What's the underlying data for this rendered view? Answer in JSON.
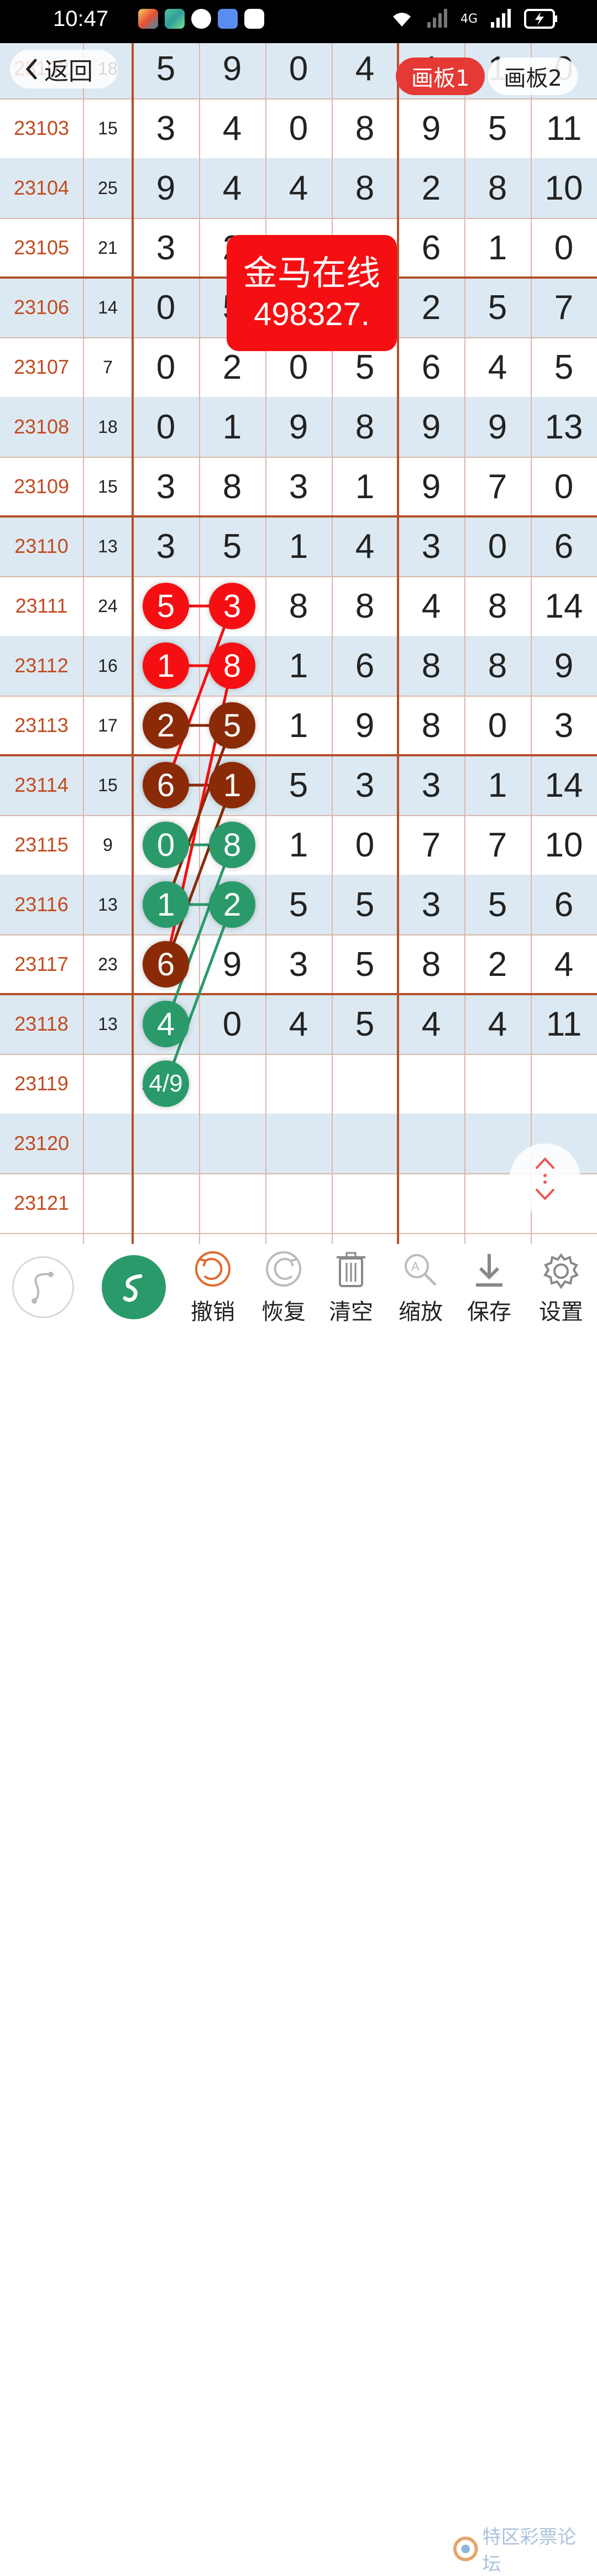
{
  "status_bar": {
    "time": "10:47",
    "network": "4G"
  },
  "nav": {
    "back_label": "返回"
  },
  "tabs": [
    {
      "label": "画板1",
      "active": true
    },
    {
      "label": "画板2",
      "active": false
    }
  ],
  "stamp": {
    "line1": "金马在线",
    "line2": "498327."
  },
  "rows": [
    {
      "id": "23102",
      "sum": "18",
      "nums": [
        "5",
        "9",
        "0",
        "4",
        "1",
        "1",
        "0"
      ]
    },
    {
      "id": "23103",
      "sum": "15",
      "nums": [
        "3",
        "4",
        "0",
        "8",
        "9",
        "5",
        "11"
      ]
    },
    {
      "id": "23104",
      "sum": "25",
      "nums": [
        "9",
        "4",
        "4",
        "8",
        "2",
        "8",
        "10"
      ]
    },
    {
      "id": "23105",
      "sum": "21",
      "nums": [
        "3",
        "2",
        "",
        "",
        "6",
        "1",
        "0"
      ]
    },
    {
      "id": "23106",
      "sum": "14",
      "nums": [
        "0",
        "5",
        "",
        "",
        "2",
        "5",
        "7"
      ]
    },
    {
      "id": "23107",
      "sum": "7",
      "nums": [
        "0",
        "2",
        "0",
        "5",
        "6",
        "4",
        "5"
      ]
    },
    {
      "id": "23108",
      "sum": "18",
      "nums": [
        "0",
        "1",
        "9",
        "8",
        "9",
        "9",
        "13"
      ]
    },
    {
      "id": "23109",
      "sum": "15",
      "nums": [
        "3",
        "8",
        "3",
        "1",
        "9",
        "7",
        "0"
      ]
    },
    {
      "id": "23110",
      "sum": "13",
      "nums": [
        "3",
        "5",
        "1",
        "4",
        "3",
        "0",
        "6"
      ]
    },
    {
      "id": "23111",
      "sum": "24",
      "nums": [
        "5",
        "3",
        "8",
        "8",
        "4",
        "8",
        "14"
      ]
    },
    {
      "id": "23112",
      "sum": "16",
      "nums": [
        "1",
        "8",
        "1",
        "6",
        "8",
        "8",
        "9"
      ]
    },
    {
      "id": "23113",
      "sum": "17",
      "nums": [
        "2",
        "5",
        "1",
        "9",
        "8",
        "0",
        "3"
      ]
    },
    {
      "id": "23114",
      "sum": "15",
      "nums": [
        "6",
        "1",
        "5",
        "3",
        "3",
        "1",
        "14"
      ]
    },
    {
      "id": "23115",
      "sum": "9",
      "nums": [
        "0",
        "8",
        "1",
        "0",
        "7",
        "7",
        "10"
      ]
    },
    {
      "id": "23116",
      "sum": "13",
      "nums": [
        "1",
        "2",
        "5",
        "5",
        "3",
        "5",
        "6"
      ]
    },
    {
      "id": "23117",
      "sum": "23",
      "nums": [
        "6",
        "9",
        "3",
        "5",
        "8",
        "2",
        "4"
      ]
    },
    {
      "id": "23118",
      "sum": "13",
      "nums": [
        "4",
        "0",
        "4",
        "5",
        "4",
        "4",
        "11"
      ]
    },
    {
      "id": "23119",
      "sum": "",
      "nums": [
        "4/9",
        "",
        "",
        "",
        "",
        "",
        ""
      ]
    },
    {
      "id": "23120",
      "sum": "",
      "nums": [
        "",
        "",
        "",
        "",
        "",
        "",
        ""
      ]
    },
    {
      "id": "23121",
      "sum": "",
      "nums": [
        "",
        "",
        "",
        "",
        "",
        "",
        ""
      ]
    }
  ],
  "balls": [
    {
      "row": 9,
      "col": 0,
      "text": "5",
      "color": "red"
    },
    {
      "row": 9,
      "col": 1,
      "text": "3",
      "color": "red"
    },
    {
      "row": 10,
      "col": 0,
      "text": "1",
      "color": "red"
    },
    {
      "row": 10,
      "col": 1,
      "text": "8",
      "color": "red"
    },
    {
      "row": 11,
      "col": 0,
      "text": "2",
      "color": "brown"
    },
    {
      "row": 11,
      "col": 1,
      "text": "5",
      "color": "brown"
    },
    {
      "row": 12,
      "col": 0,
      "text": "6",
      "color": "brown"
    },
    {
      "row": 12,
      "col": 1,
      "text": "1",
      "color": "brown"
    },
    {
      "row": 13,
      "col": 0,
      "text": "0",
      "color": "green"
    },
    {
      "row": 13,
      "col": 1,
      "text": "8",
      "color": "green"
    },
    {
      "row": 14,
      "col": 0,
      "text": "1",
      "color": "green"
    },
    {
      "row": 14,
      "col": 1,
      "text": "2",
      "color": "green"
    },
    {
      "row": 15,
      "col": 0,
      "text": "6",
      "color": "brown"
    },
    {
      "row": 16,
      "col": 0,
      "text": "4",
      "color": "green"
    },
    {
      "row": 17,
      "col": 0,
      "text": "4/9",
      "color": "green"
    }
  ],
  "links": [
    {
      "from": [
        9,
        0
      ],
      "to": [
        9,
        1
      ],
      "color": "red"
    },
    {
      "from": [
        10,
        0
      ],
      "to": [
        10,
        1
      ],
      "color": "red"
    },
    {
      "from": [
        11,
        0
      ],
      "to": [
        11,
        1
      ],
      "color": "brown"
    },
    {
      "from": [
        12,
        0
      ],
      "to": [
        12,
        1
      ],
      "color": "brown"
    },
    {
      "from": [
        13,
        0
      ],
      "to": [
        13,
        1
      ],
      "color": "green"
    },
    {
      "from": [
        14,
        0
      ],
      "to": [
        14,
        1
      ],
      "color": "green"
    },
    {
      "from": [
        9,
        1
      ],
      "to": [
        12,
        0
      ],
      "color": "red"
    },
    {
      "from": [
        10,
        1
      ],
      "to": [
        15,
        0
      ],
      "color": "red"
    },
    {
      "from": [
        11,
        1
      ],
      "to": [
        14,
        0
      ],
      "color": "brown"
    },
    {
      "from": [
        12,
        1
      ],
      "to": [
        15,
        0
      ],
      "color": "brown"
    },
    {
      "from": [
        13,
        1
      ],
      "to": [
        16,
        0
      ],
      "color": "green"
    },
    {
      "from": [
        14,
        1
      ],
      "to": [
        17,
        0
      ],
      "color": "green"
    }
  ],
  "colors": {
    "red": "#f50f12",
    "brown": "#8b2a06",
    "green": "#2a9a6a",
    "row_alt": "#dde9f2",
    "grid_thick": "#b5502a",
    "id_text": "#c34a1e"
  },
  "toolbar": {
    "items": [
      {
        "label": "撤销",
        "icon": "undo-icon"
      },
      {
        "label": "恢复",
        "icon": "redo-icon"
      },
      {
        "label": "清空",
        "icon": "trash-icon"
      },
      {
        "label": "缩放",
        "icon": "zoom-icon"
      },
      {
        "label": "保存",
        "icon": "save-icon"
      },
      {
        "label": "设置",
        "icon": "gear-icon"
      }
    ]
  },
  "watermark": {
    "text": "特区彩票论坛"
  }
}
